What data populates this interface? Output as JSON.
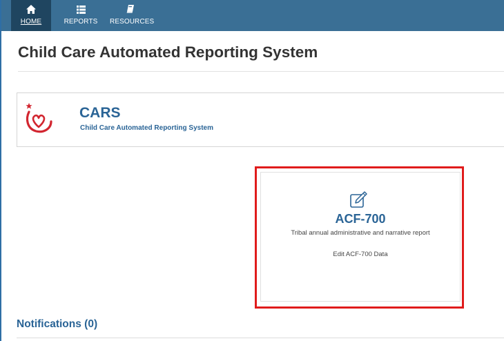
{
  "nav": {
    "items": [
      {
        "label": "HOME",
        "icon": "home-icon",
        "active": true
      },
      {
        "label": "REPORTS",
        "icon": "list-icon",
        "active": false
      },
      {
        "label": "RESOURCES",
        "icon": "book-icon",
        "active": false
      }
    ]
  },
  "page": {
    "title": "Child Care Automated Reporting System"
  },
  "brand": {
    "name": "CARS",
    "subtitle": "Child Care Automated Reporting System"
  },
  "card": {
    "icon": "edit-icon",
    "title": "ACF-700",
    "description": "Tribal annual administrative and narrative report",
    "link": "Edit ACF-700 Data"
  },
  "notifications": {
    "title": "Notifications (0)"
  },
  "colors": {
    "nav_bg": "#3a6f95",
    "nav_active": "#1f4560",
    "brand_blue": "#2a6496",
    "highlight_red": "#e01b1b",
    "logo_red": "#d22630"
  }
}
